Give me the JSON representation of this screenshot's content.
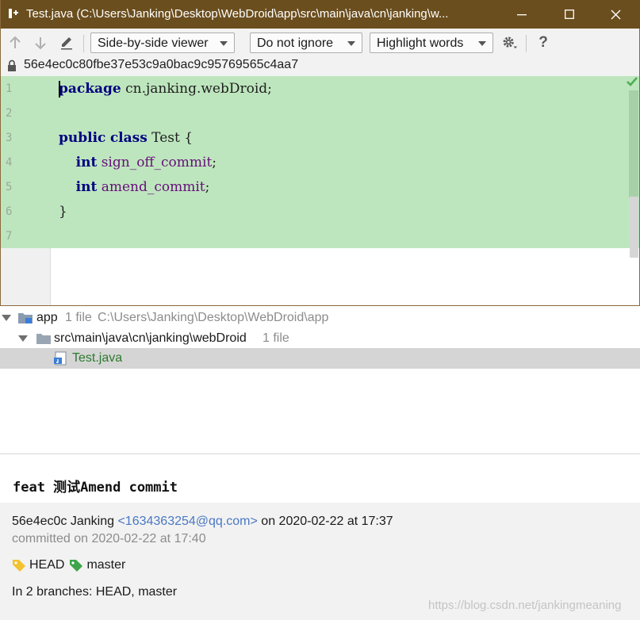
{
  "window": {
    "title": "Test.java (C:\\Users\\Janking\\Desktop\\WebDroid\\app\\src\\main\\java\\cn\\janking\\w...",
    "title_color": "#6b4e1e"
  },
  "toolbar": {
    "prev_icon": "arrow-up-icon",
    "next_icon": "arrow-down-icon",
    "edit_icon": "edit-icon",
    "viewer_mode": "Side-by-side viewer",
    "whitespace_mode": "Do not ignore",
    "highlight_mode": "Highlight words",
    "settings_icon": "gear-icon",
    "help_label": "?"
  },
  "revision": {
    "hash": "56e4ec0c80fbe37e53c9a0bac9c95769565c4aa7"
  },
  "editor": {
    "added_color": "#bee6be",
    "lines": [
      {
        "num": "1",
        "parts": [
          {
            "t": "package",
            "c": "kw"
          },
          {
            "t": " cn.janking.webDroid;",
            "c": ""
          }
        ]
      },
      {
        "num": "2",
        "parts": []
      },
      {
        "num": "3",
        "parts": [
          {
            "t": "public",
            "c": "kw"
          },
          {
            "t": " ",
            "c": ""
          },
          {
            "t": "class",
            "c": "kw"
          },
          {
            "t": " Test {",
            "c": ""
          }
        ]
      },
      {
        "num": "4",
        "parts": [
          {
            "t": "    ",
            "c": ""
          },
          {
            "t": "int",
            "c": "kw"
          },
          {
            "t": " ",
            "c": ""
          },
          {
            "t": "sign_off_commit",
            "c": "fld"
          },
          {
            "t": ";",
            "c": ""
          }
        ]
      },
      {
        "num": "5",
        "parts": [
          {
            "t": "    ",
            "c": ""
          },
          {
            "t": "int",
            "c": "kw"
          },
          {
            "t": " ",
            "c": ""
          },
          {
            "t": "amend_commit",
            "c": "fld"
          },
          {
            "t": ";",
            "c": ""
          }
        ]
      },
      {
        "num": "6",
        "parts": [
          {
            "t": "}",
            "c": ""
          }
        ]
      },
      {
        "num": "7",
        "parts": []
      }
    ]
  },
  "tree": {
    "root": {
      "name": "app",
      "count": "1 file",
      "path": "C:\\Users\\Janking\\Desktop\\WebDroid\\app"
    },
    "folder": {
      "name": "src\\main\\java\\cn\\janking\\webDroid",
      "count": "1 file"
    },
    "file": {
      "name": "Test.java"
    }
  },
  "commit": {
    "subject": "feat 测试Amend commit",
    "short_hash": "56e4ec0c",
    "author": "Janking",
    "email": "<1634363254@qq.com>",
    "authored_on": "on 2020-02-22 at 17:37",
    "committed": "committed on 2020-02-22 at 17:40",
    "refs": [
      "HEAD",
      "master"
    ],
    "branches": "In 2 branches: HEAD, master"
  },
  "watermark": "https://blog.csdn.net/jankingmeaning"
}
